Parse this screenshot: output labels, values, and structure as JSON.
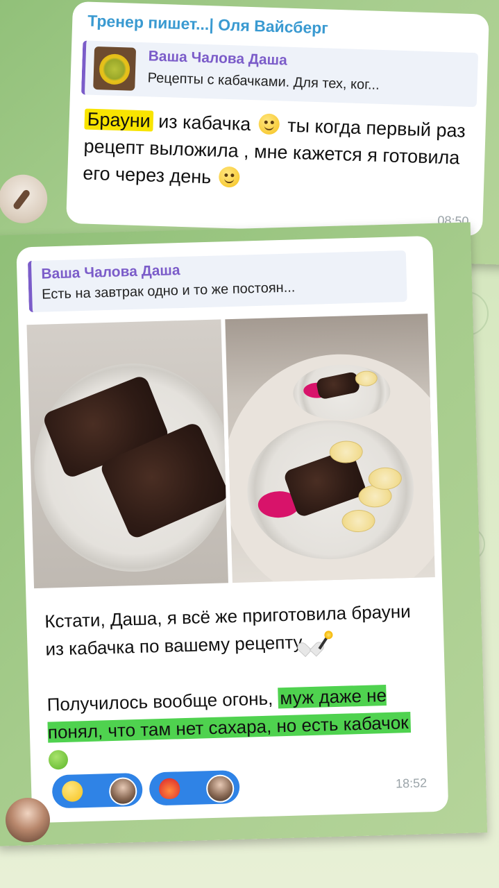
{
  "shot1": {
    "sender": "Тренер пишет...| Оля Вайсберг",
    "reply": {
      "name": "Ваша Чалова Даша",
      "text": "Рецепты с кабачками. Для тех, ког..."
    },
    "message": {
      "highlight": "Брауни",
      "rest_line1": " из кабачка",
      "rest_line2": " ты когда первый раз рецепт выложила , мне кажется я готовила его через день "
    },
    "time": "08:50"
  },
  "shot2": {
    "reply": {
      "name": "Ваша Чалова Даша",
      "text": "Есть на завтрак одно и то же постоян..."
    },
    "message": {
      "para1": "Кстати, Даша, я всё же приготовила брауни из кабачка по вашему рецепту",
      "para2_plain": "Получилось вообще огонь, ",
      "para2_highlight": "муж даже не понял, что там нет сахара, но есть кабачок"
    },
    "time": "18:52"
  },
  "icons": {
    "emoji_grin": "grinning-face-icon",
    "emoji_drool": "drooling-face-icon",
    "emoji_laugh": "rolling-laughing-icon",
    "heart": "white-heart-icon",
    "wand": "magic-wand-icon",
    "fire": "heart-on-fire-icon"
  },
  "colors": {
    "sender_name": "#3a9ad1",
    "reply_accent": "#7b5cc9",
    "highlight_yellow": "#f8e400",
    "highlight_green": "#4fd24f",
    "reaction_bg": "#2f83e6",
    "chat_bg": "#a6cc8c"
  }
}
